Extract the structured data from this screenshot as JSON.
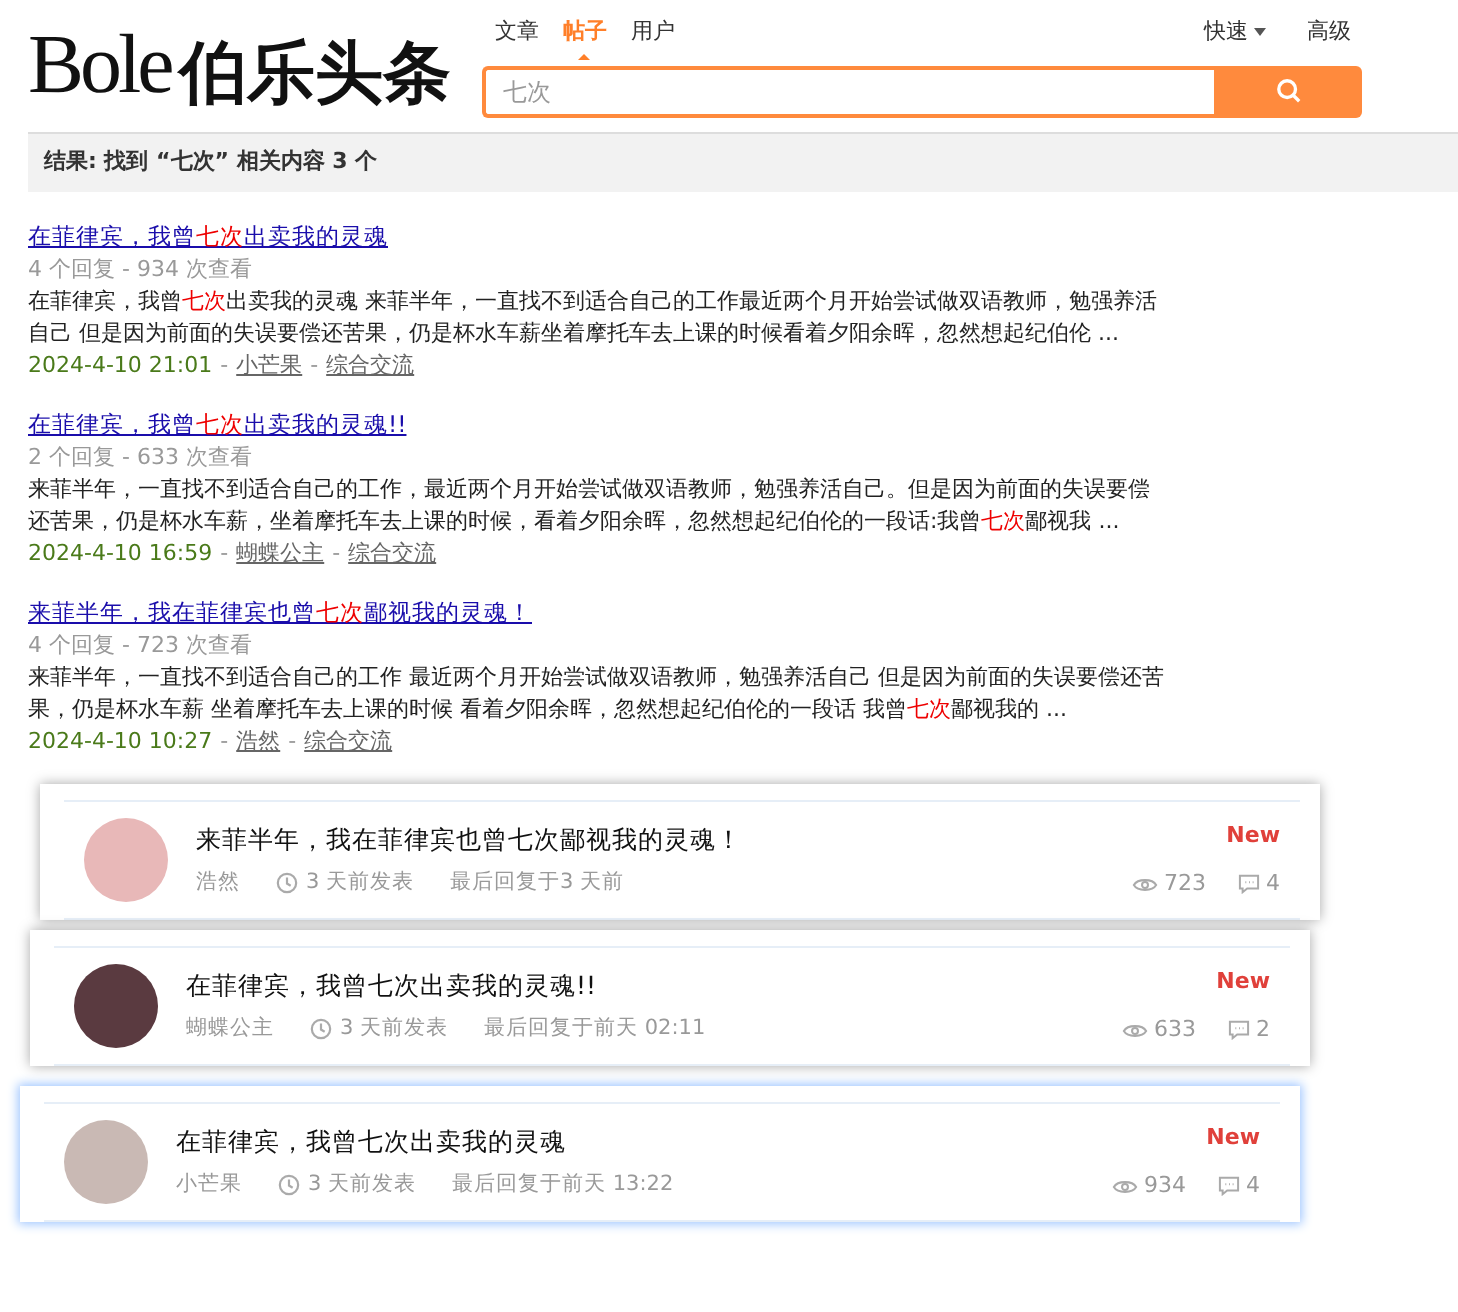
{
  "logo": {
    "latin": "Bole",
    "chinese": "伯乐头条"
  },
  "search_tabs": [
    {
      "label": "文章",
      "selected": false
    },
    {
      "label": "帖子",
      "selected": true
    },
    {
      "label": "用户",
      "selected": false
    }
  ],
  "search": {
    "value": "七次"
  },
  "quick_menu": {
    "label": "快速"
  },
  "advanced_link": "高级",
  "result_summary": "结果: 找到 “七次” 相关内容 3 个",
  "results": [
    {
      "title": [
        {
          "text": "在菲律宾，我曾",
          "kind": "plain"
        },
        {
          "text": "七次",
          "kind": "keyword"
        },
        {
          "text": "出卖我的灵魂",
          "kind": "plain"
        }
      ],
      "stats": "4 个回复 - 934 次查看",
      "excerpt": [
        {
          "text": "在菲律宾，我曾",
          "kind": "plain"
        },
        {
          "text": "七次",
          "kind": "keyword"
        },
        {
          "text": "出卖我的灵魂 来菲半年，一直找不到适合自己的工作最近两个月开始尝试做双语教师，勉强养活自己 但是因为前面的失误要偿还苦果，仍是杯水车薪坐着摩托车去上课的时候看着夕阳余晖，忽然想起纪伯伦 ...",
          "kind": "plain"
        }
      ],
      "date": "2024-4-10 21:01",
      "separator_1": "-",
      "author": "小芒果",
      "separator_2": "-",
      "forum": "综合交流"
    },
    {
      "title": [
        {
          "text": "在菲律宾，我曾",
          "kind": "plain"
        },
        {
          "text": "七次",
          "kind": "keyword"
        },
        {
          "text": "出卖我的灵魂!!",
          "kind": "plain"
        }
      ],
      "stats": "2 个回复 - 633 次查看",
      "excerpt": [
        {
          "text": "来菲半年，一直找不到适合自己的工作，最近两个月开始尝试做双语教师，勉强养活自己。但是因为前面的失误要偿还苦果，仍是杯水车薪，坐着摩托车去上课的时候，看着夕阳余晖，忽然想起纪伯伦的一段话:我曾",
          "kind": "plain"
        },
        {
          "text": "七次",
          "kind": "keyword"
        },
        {
          "text": "鄙视我 ...",
          "kind": "plain"
        }
      ],
      "date": "2024-4-10 16:59",
      "separator_1": "-",
      "author": "蝴蝶公主",
      "separator_2": "-",
      "forum": "综合交流"
    },
    {
      "title": [
        {
          "text": "来菲半年，我在菲律宾也曾",
          "kind": "plain"
        },
        {
          "text": "七次",
          "kind": "keyword"
        },
        {
          "text": "鄙视我的灵魂！",
          "kind": "plain"
        }
      ],
      "stats": "4 个回复 - 723 次查看",
      "excerpt": [
        {
          "text": "来菲半年，一直找不到适合自己的工作 最近两个月开始尝试做双语教师，勉强养活自己 但是因为前面的失误要偿还苦果，仍是杯水车薪 坐着摩托车去上课的时候 看着夕阳余晖，忽然想起纪伯伦的一段话 我曾",
          "kind": "plain"
        },
        {
          "text": "七次",
          "kind": "keyword"
        },
        {
          "text": "鄙视我的 ...",
          "kind": "plain"
        }
      ],
      "date": "2024-4-10 10:27",
      "separator_1": "-",
      "author": "浩然",
      "separator_2": "-",
      "forum": "综合交流"
    }
  ],
  "thread_cards": [
    {
      "title": "来菲半年，我在菲律宾也曾七次鄙视我的灵魂！",
      "author": "浩然",
      "posted": "3 天前发表",
      "last_reply": "最后回复于3 天前",
      "badge": "New",
      "views": "723",
      "replies": "4",
      "focused": false,
      "color": "#e8b8b8"
    },
    {
      "title": "在菲律宾，我曾七次出卖我的灵魂!!",
      "author": "蝴蝶公主",
      "posted": "3 天前发表",
      "last_reply": "最后回复于前天 02:11",
      "badge": "New",
      "views": "633",
      "replies": "2",
      "focused": false,
      "color": "#5a3a40"
    },
    {
      "title": "在菲律宾，我曾七次出卖我的灵魂",
      "author": "小芒果",
      "posted": "3 天前发表",
      "last_reply": "最后回复于前天 13:22",
      "badge": "New",
      "views": "934",
      "replies": "4",
      "focused": true,
      "color": "#c9b9b4"
    }
  ]
}
